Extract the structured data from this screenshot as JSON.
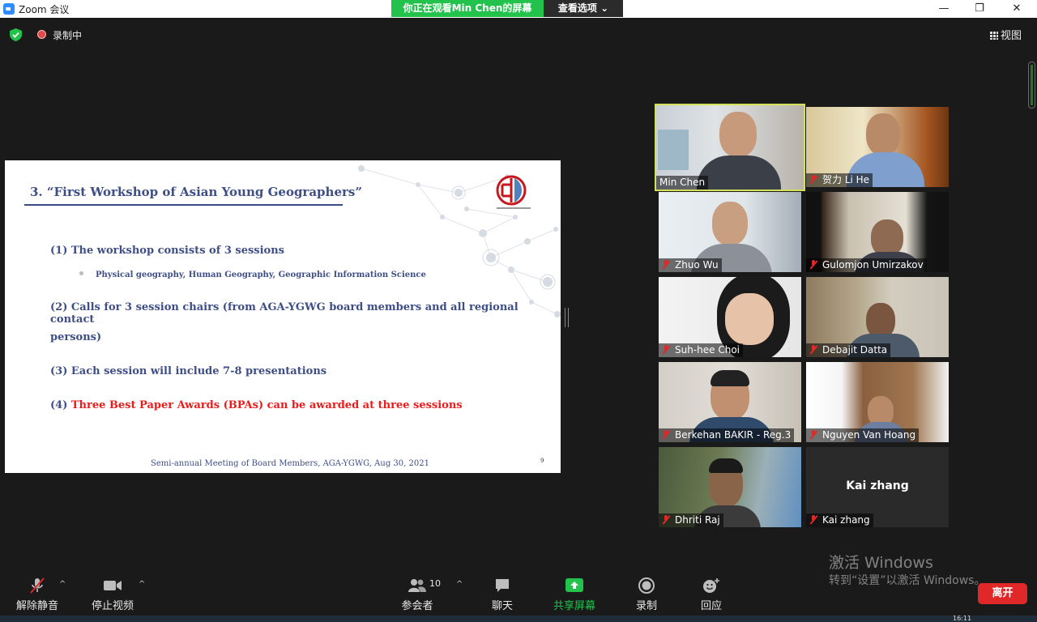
{
  "window": {
    "app_title": "Zoom 会议",
    "banner_text": "你正在观看Min Chen的屏幕",
    "view_options_label": "查看选项",
    "minimize_glyph": "—",
    "restore_glyph": "❐",
    "close_glyph": "✕"
  },
  "top_bar": {
    "recording_label": "录制中",
    "view_label": "视图"
  },
  "slide": {
    "title": "3. “First Workshop of Asian Young Geographers”",
    "items": [
      "(1) The workshop consists of 3 sessions",
      "(2) Calls for 3 session chairs (from AGA-YGWG board members and all regional contact",
      "persons)",
      "(3) Each session will include 7-8 presentations"
    ],
    "sub_item": "Physical geography, Human Geography, Geographic Information Science",
    "item4_prefix": "(4) ",
    "item4_highlight": "Three Best Paper Awards (BPAs) can be awarded at three sessions",
    "footer": "Semi-annual Meeting of Board Members, AGA-YGWG, Aug 30, 2021",
    "page_number": "9",
    "accent_color": "#3e4e86",
    "highlight_color": "#ee1b1b"
  },
  "participants": [
    {
      "name": "Min Chen",
      "muted": false,
      "active": true
    },
    {
      "name": "贺力 Li He",
      "muted": true
    },
    {
      "name": "Zhuo Wu",
      "muted": true
    },
    {
      "name": "Gulomjon Umirzakov",
      "muted": true
    },
    {
      "name": "Suh-hee Choi",
      "muted": true
    },
    {
      "name": "Debajit Datta",
      "muted": true
    },
    {
      "name": "Berkehan BAKIR - Reg.3",
      "muted": true
    },
    {
      "name": "Nguyen Van Hoang",
      "muted": true
    },
    {
      "name": "Dhriti Raj",
      "muted": true
    },
    {
      "name": "Kai zhang",
      "muted": true,
      "video_off": true
    }
  ],
  "watermark": {
    "line1": "激活 Windows",
    "line2": "转到“设置”以激活 Windows。"
  },
  "toolbar": {
    "unmute_label": "解除静音",
    "stop_video_label": "停止视频",
    "participants_label": "参会者",
    "participants_count": "10",
    "chat_label": "聊天",
    "share_label": "共享屏幕",
    "record_label": "录制",
    "reactions_label": "回应",
    "leave_label": "离开",
    "share_color": "#23c24d",
    "leave_color": "#e02828"
  },
  "taskbar": {
    "clock": "16:11"
  }
}
